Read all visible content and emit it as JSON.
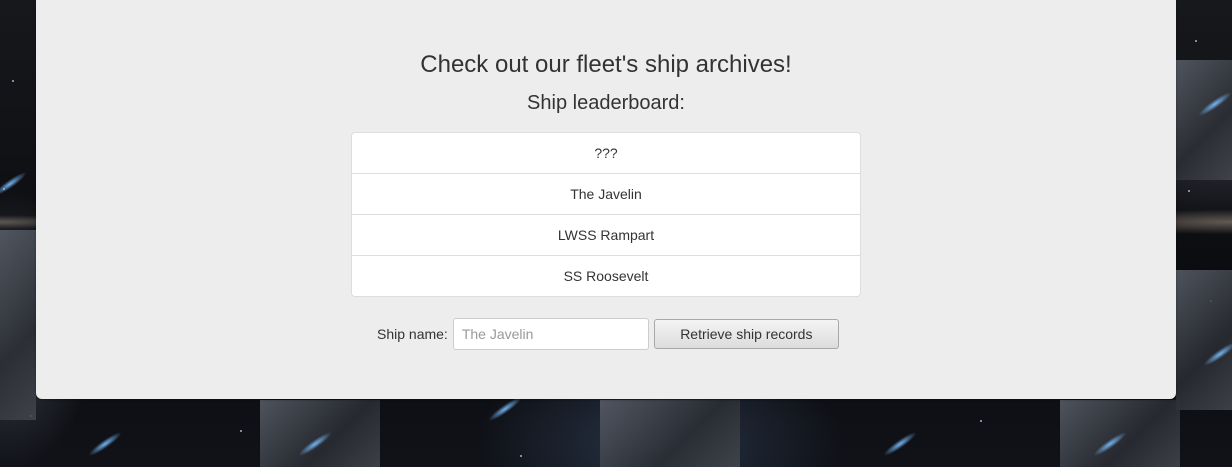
{
  "page": {
    "title": "Check out our fleet's ship archives!",
    "subtitle": "Ship leaderboard:"
  },
  "leaderboard": {
    "items": [
      {
        "label": "???"
      },
      {
        "label": "The Javelin"
      },
      {
        "label": "LWSS Rampart"
      },
      {
        "label": "SS Roosevelt"
      }
    ]
  },
  "search": {
    "label": "Ship name:",
    "placeholder": "The Javelin",
    "value": "",
    "button_label": "Retrieve ship records"
  },
  "colors": {
    "panel_background": "#ededed",
    "text": "#333333",
    "list_background": "#ffffff",
    "list_border": "#dddddd"
  }
}
